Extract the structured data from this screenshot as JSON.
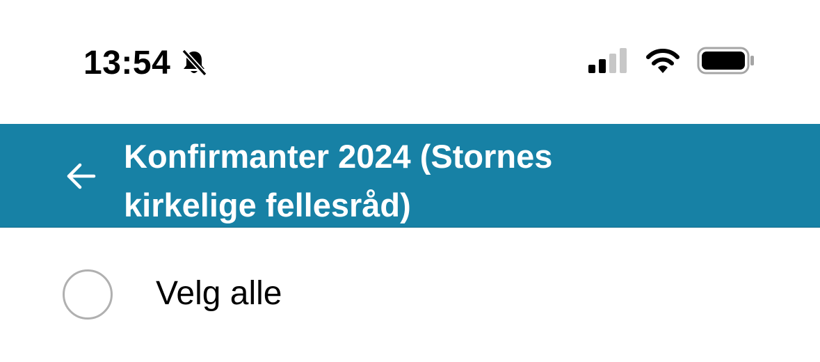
{
  "status_bar": {
    "time": "13:54",
    "mute_icon": "bell-slash-icon",
    "signal_icon": "cellular-signal-icon",
    "wifi_icon": "wifi-icon",
    "battery_icon": "battery-icon"
  },
  "header": {
    "back_icon": "arrow-left-icon",
    "title_line1": "Konfirmanter 2024 (Stornes",
    "title_line2": "kirkelige fellesråd)",
    "background_color": "#1781a5"
  },
  "select_all": {
    "label": "Velg alle",
    "checked": false
  }
}
